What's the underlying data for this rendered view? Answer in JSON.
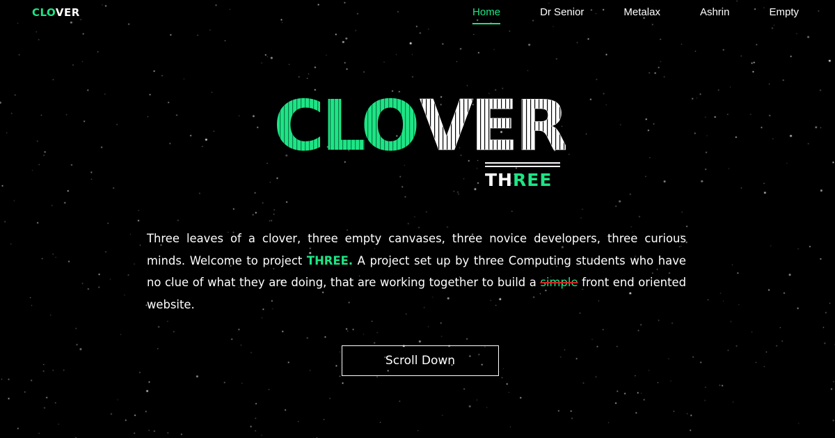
{
  "header": {
    "logo": {
      "part1": "CLO",
      "part2": "VER"
    },
    "nav": [
      {
        "label": "Home",
        "active": true
      },
      {
        "label": "Dr Senior",
        "active": false
      },
      {
        "label": "Metalax",
        "active": false
      },
      {
        "label": "Ashrin",
        "active": false
      },
      {
        "label": "Empty",
        "active": false
      }
    ]
  },
  "hero": {
    "title_part1": "CLO",
    "title_part2": "VER",
    "subtitle_part1": "TH",
    "subtitle_part2": "REE"
  },
  "intro": {
    "text_before": "Three leaves of a clover, three empty canvases, three novice developers, three curious minds. Welcome to project ",
    "highlight": "THREE.",
    "text_middle": " A project set up by three Computing students who have no clue of what they are doing, that are working together to build a ",
    "struck_word": "simple",
    "text_after": " front end oriented website."
  },
  "cta": {
    "label": "Scroll Down"
  },
  "colors": {
    "accent": "#1de585",
    "background": "#000000",
    "text": "#ffffff",
    "strike": "#e02020"
  }
}
